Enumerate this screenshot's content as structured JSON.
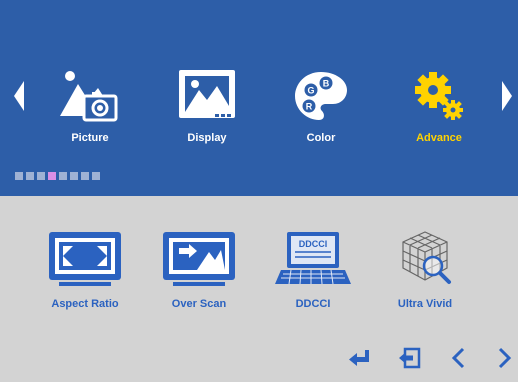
{
  "colors": {
    "header_bg": "#2d5ea8",
    "body_bg": "#d3d3d3",
    "label_white": "#ffffff",
    "label_active": "#ffd200",
    "icon_blue": "#2b62c0"
  },
  "main_menu": {
    "items": [
      {
        "label": "Picture",
        "icon": "picture-icon",
        "active": false
      },
      {
        "label": "Display",
        "icon": "display-icon",
        "active": false
      },
      {
        "label": "Color",
        "icon": "color-palette-icon",
        "active": false
      },
      {
        "label": "Advance",
        "icon": "gear-icon",
        "active": true
      }
    ],
    "page_dots": {
      "total": 8,
      "active_index": 3
    }
  },
  "submenu": {
    "items": [
      {
        "label": "Aspect Ratio",
        "icon": "aspect-ratio-icon"
      },
      {
        "label": "Over Scan",
        "icon": "over-scan-icon"
      },
      {
        "label": "DDCCI",
        "icon": "ddcci-icon",
        "screen_text": "DDCCI"
      },
      {
        "label": "Ultra Vivid",
        "icon": "ultra-vivid-icon"
      }
    ]
  },
  "bottom_controls": [
    {
      "icon": "enter-icon"
    },
    {
      "icon": "exit-icon"
    },
    {
      "icon": "left-chevron-icon"
    },
    {
      "icon": "right-chevron-icon"
    }
  ]
}
